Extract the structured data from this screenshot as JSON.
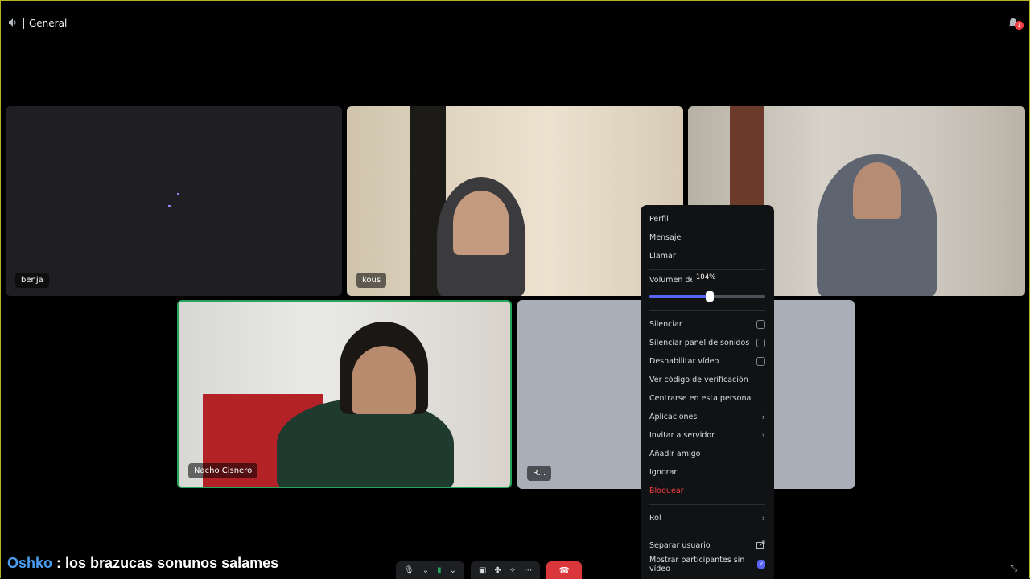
{
  "channel": {
    "name": "General",
    "icon": "speaker-icon"
  },
  "notifications": {
    "count": "1",
    "icon": "bell-icon"
  },
  "participants": [
    {
      "name": "benja"
    },
    {
      "name": "kous"
    },
    {
      "name": ""
    },
    {
      "name": "Nacho Cisnero",
      "speaking": true
    },
    {
      "name": "R..."
    }
  ],
  "context_menu": {
    "items_top": [
      "Perfil",
      "Mensaje",
      "Llamar"
    ],
    "volume_label": "Volumen de u",
    "volume_value": "104%",
    "volume_fraction": 0.52,
    "checkbox_items": [
      {
        "label": "Silenciar",
        "checked": false
      },
      {
        "label": "Silenciar panel de sonidos",
        "checked": false
      },
      {
        "label": "Deshabilitar vídeo",
        "checked": false
      }
    ],
    "items_mid": [
      "Ver código de verificación",
      "Centrarse en esta persona"
    ],
    "submenus": [
      "Aplicaciones",
      "Invitar a servidor"
    ],
    "items_low": [
      "Añadir amigo",
      "Ignorar"
    ],
    "danger_item": "Bloquear",
    "role_item": "Rol",
    "popout_item": "Separar usuario",
    "show_no_video": {
      "label": "Mostrar participantes sin vídeo",
      "checked": true
    }
  },
  "chat_overlay": {
    "user": "Oshko",
    "separator": ":",
    "message": "los brazucas sonunos salames"
  },
  "colors": {
    "accent": "#5865f2",
    "danger": "#f23f43",
    "speaking": "#23a55a",
    "username": "#4a9ff5"
  }
}
